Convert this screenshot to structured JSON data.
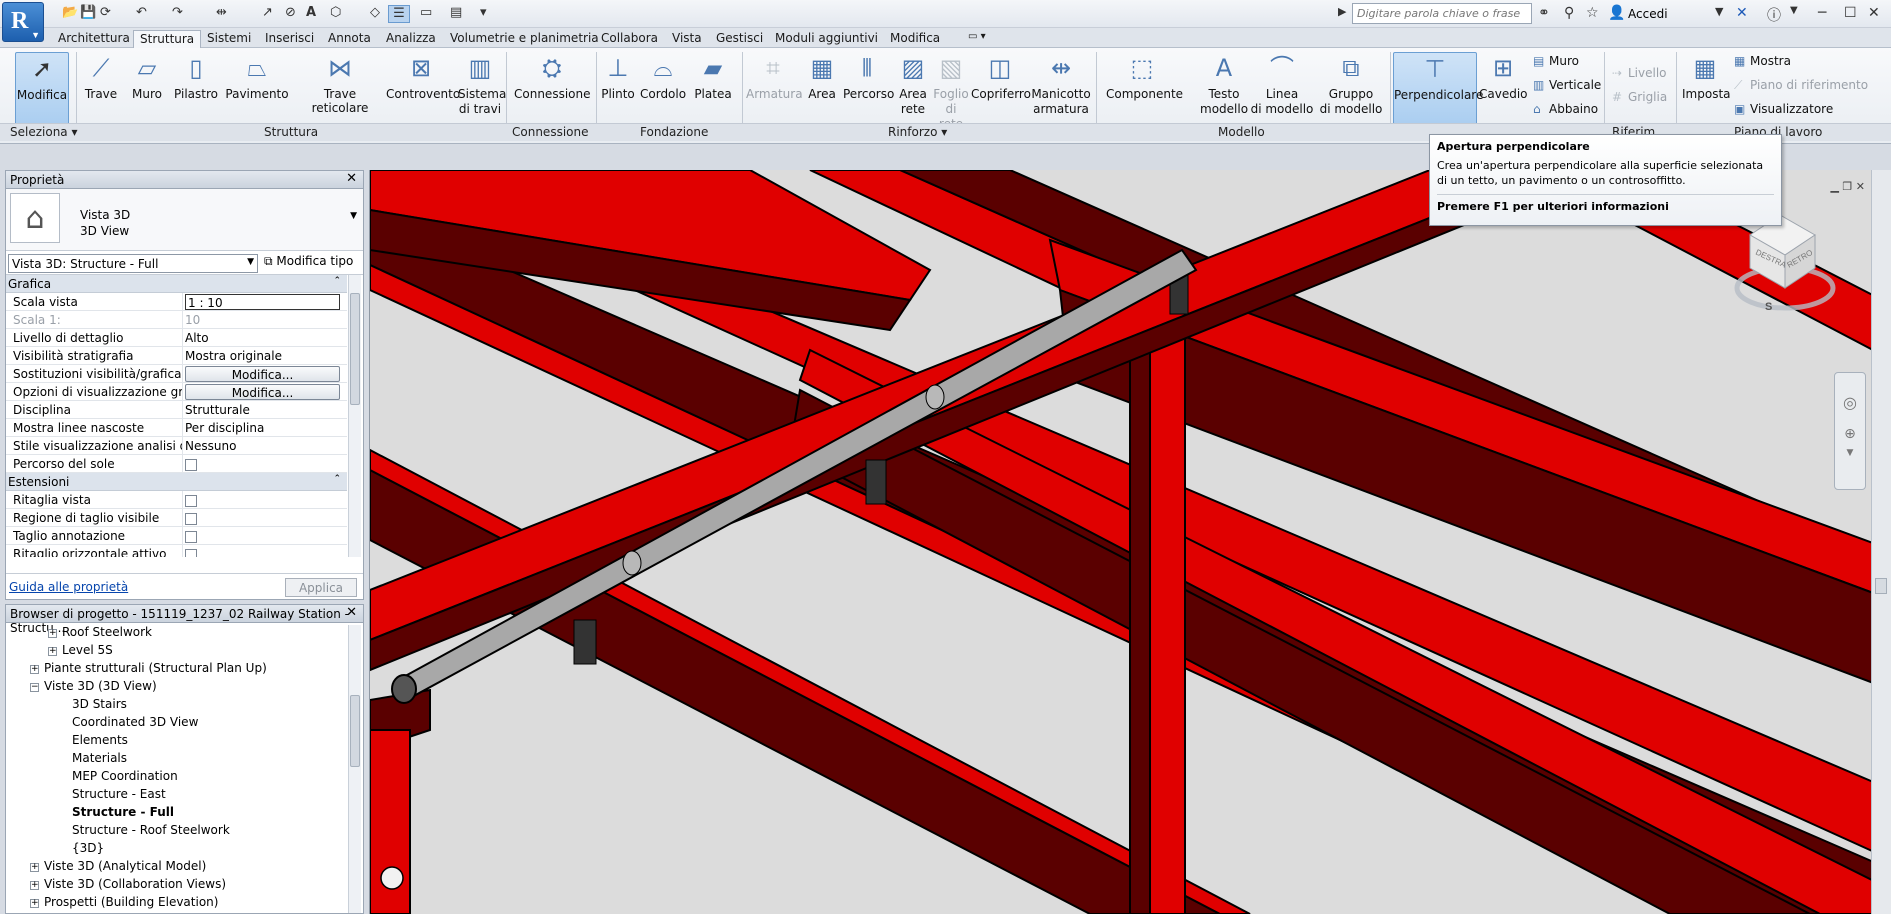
{
  "app": {
    "logo": "R"
  },
  "search": {
    "placeholder": "Digitare parola chiave o frase"
  },
  "account": {
    "sign_in": "Accedi"
  },
  "tabs": [
    "Architettura",
    "Struttura",
    "Sistemi",
    "Inserisci",
    "Annota",
    "Analizza",
    "Volumetrie e planimetria",
    "Collabora",
    "Vista",
    "Gestisci",
    "Moduli aggiuntivi",
    "Modifica"
  ],
  "active_tab": "Struttura",
  "ribbon": {
    "modify": "Modifica",
    "beam": "Trave",
    "wall": "Muro",
    "column": "Pilastro",
    "floor": "Pavimento",
    "truss": "Trave reticolare",
    "brace": "Controvento",
    "beam_system_1": "Sistema",
    "beam_system_2": "di travi",
    "connection": "Connessione",
    "isolated": "Plinto",
    "wall_found": "Cordolo",
    "slab": "Platea",
    "rebar": "Armatura",
    "area": "Area",
    "path": "Percorso",
    "area_net_1": "Area",
    "area_net_2": "rete",
    "sheet_1": "Foglio",
    "sheet_2": "di rete",
    "cover": "Copriferro",
    "coupler_1": "Manicotto",
    "coupler_2": "armatura",
    "component": "Componente",
    "model_text_1": "Testo",
    "model_text_2": "modello",
    "model_line_1": "Linea",
    "model_line_2": "di modello",
    "model_group_1": "Gruppo",
    "model_group_2": "di modello",
    "by_face": "Perpendicolare",
    "shaft": "Cavedio",
    "opening_wall": "Muro",
    "opening_vertical": "Verticale",
    "dormer": "Abbaino",
    "level": "Livello",
    "grid": "Griglia",
    "set": "Imposta",
    "show": "Mostra",
    "ref_plane": "Piano di riferimento",
    "viewer": "Visualizzatore",
    "panels": {
      "select": "Seleziona",
      "structure": "Struttura",
      "connection": "Connessione",
      "foundation": "Fondazione",
      "reinforcement": "Rinforzo",
      "model": "Modello",
      "datum": "Riferim...",
      "work_plane": "Piano di lavoro"
    }
  },
  "tooltip": {
    "title": "Apertura perpendicolare",
    "body": "Crea un'apertura perpendicolare alla superficie selezionata di un tetto, un pavimento o un controsoffitto.",
    "footer": "Premere F1 per ulteriori informazioni"
  },
  "properties": {
    "title": "Proprietà",
    "type_name_1": "Vista 3D",
    "type_name_2": "3D View",
    "instance": "Vista 3D: Structure - Full",
    "edit_type": "Modifica tipo",
    "sections": {
      "graphics": "Grafica",
      "extents": "Estensioni"
    },
    "rows": [
      {
        "key": "Scala vista",
        "value": "1 : 10"
      },
      {
        "key": "Scala 1:",
        "value": "10"
      },
      {
        "key": "Livello di dettaglio",
        "value": "Alto"
      },
      {
        "key": "Visibilità stratigrafia",
        "value": "Mostra originale"
      },
      {
        "key": "Sostituzioni visibilità/grafica",
        "value": "Modifica..."
      },
      {
        "key": "Opzioni di visualizzazione gr...",
        "value": "Modifica..."
      },
      {
        "key": "Disciplina",
        "value": "Strutturale"
      },
      {
        "key": "Mostra linee nascoste",
        "value": "Per disciplina"
      },
      {
        "key": "Stile visualizzazione analisi di...",
        "value": "Nessuno"
      },
      {
        "key": "Percorso del sole",
        "value": ""
      }
    ],
    "extent_rows": [
      {
        "key": "Ritaglia vista"
      },
      {
        "key": "Regione di taglio visibile"
      },
      {
        "key": "Taglio annotazione"
      },
      {
        "key": "Ritaglio orizzontale attivo"
      }
    ],
    "help": "Guida alle proprietà",
    "apply": "Applica"
  },
  "browser": {
    "title": "Browser di progetto - 151119_1237_02 Railway Station - Structu...",
    "items": [
      {
        "label": "Roof Steelwork",
        "toggle": "+"
      },
      {
        "label": "Level 5S",
        "toggle": "+"
      },
      {
        "label": "Piante strutturali (Structural Plan Up)",
        "toggle": "+"
      },
      {
        "label": "Viste 3D (3D View)",
        "toggle": "−"
      },
      {
        "label": "3D Stairs"
      },
      {
        "label": "Coordinated 3D View"
      },
      {
        "label": "Elements"
      },
      {
        "label": "Materials"
      },
      {
        "label": "MEP Coordination"
      },
      {
        "label": "Structure - East"
      },
      {
        "label": "Structure - Full"
      },
      {
        "label": "Structure - Roof Steelwork"
      },
      {
        "label": "{3D}"
      },
      {
        "label": "Viste 3D (Analytical Model)",
        "toggle": "+"
      },
      {
        "label": "Viste 3D (Collaboration Views)",
        "toggle": "+"
      },
      {
        "label": "Prospetti (Building Elevation)",
        "toggle": "+"
      }
    ]
  },
  "viewcube": {
    "front": "DESTRA",
    "right": "RETRO",
    "compass_south": "S"
  },
  "colors": {
    "steel_red": "#e00000",
    "steel_dark": "#5a0000",
    "pipe": "#a8a8a8",
    "accent": "#3a7bd5"
  }
}
